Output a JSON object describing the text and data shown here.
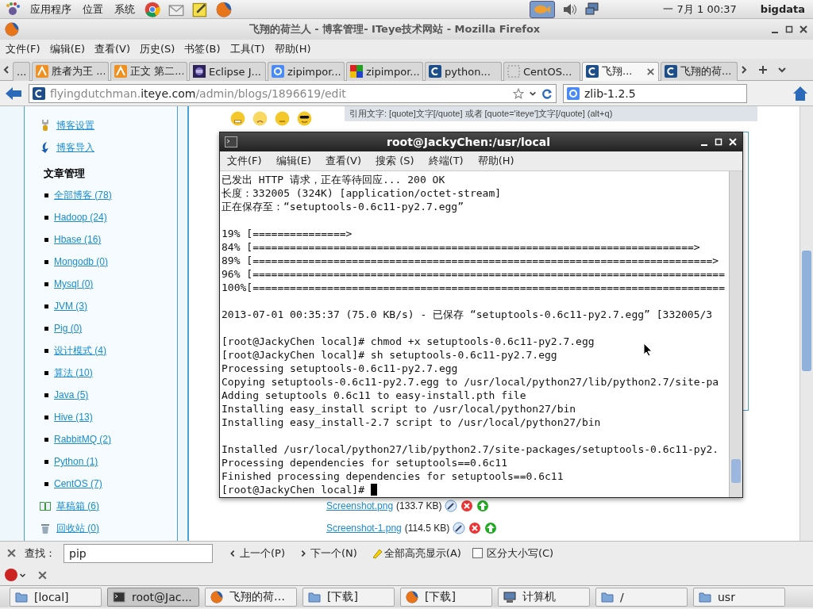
{
  "top_panel": {
    "menus": [
      "应用程序",
      "位置",
      "系统"
    ],
    "launchers": [
      {
        "kind": "chrome"
      },
      {
        "kind": "mail"
      },
      {
        "kind": "note"
      },
      {
        "kind": "firefox"
      }
    ],
    "clock": "一 7月  1 00:37",
    "user": "bigdata"
  },
  "window": {
    "title": "飞翔的荷兰人 - 博客管理- ITeye技术网站 - Mozilla Firefox"
  },
  "menu": [
    "文件(F)",
    "编辑(E)",
    "查看(V)",
    "历史(S)",
    "书签(B)",
    "工具(T)",
    "帮助(H)"
  ],
  "tabs": [
    {
      "label": "...",
      "kind": "none",
      "selected": false
    },
    {
      "label": "胜者为王 ...",
      "kind": "iteye",
      "selected": false
    },
    {
      "label": "正文 第二...",
      "kind": "iteye",
      "selected": false
    },
    {
      "label": "Eclipse J...",
      "kind": "eclipse",
      "selected": false
    },
    {
      "label": "zipimpor...",
      "kind": "google",
      "selected": false
    },
    {
      "label": "zipimpor...",
      "kind": "mosaic",
      "selected": false
    },
    {
      "label": "python...",
      "kind": "site",
      "selected": false
    },
    {
      "label": "CentOS...",
      "kind": "blank",
      "selected": false
    },
    {
      "label": "飞翔...",
      "kind": "site",
      "selected": true
    },
    {
      "label": "飞翔的荷...",
      "kind": "site",
      "selected": false
    }
  ],
  "navbar": {
    "url_host": "flyingdutchman.",
    "url_domain": "iteye.com",
    "url_path": "/admin/blogs/1896619/edit",
    "search": "zlib-1.2.5"
  },
  "sidebar": {
    "links": [
      {
        "kind": "wrench",
        "label": "博客设置"
      },
      {
        "kind": "import",
        "label": "博客导入"
      }
    ],
    "heading": "文章管理",
    "categories": [
      "全部博客 (78)",
      "Hadoop (24)",
      "Hbase (16)",
      "Mongodb (0)",
      "Mysql (0)",
      "JVM (3)",
      "Pig (0)",
      "设计模式 (4)",
      "算法 (10)",
      "Java (5)",
      "Hive (13)",
      "RabbitMQ (2)",
      "Python (1)",
      "CentOS (7)"
    ],
    "extras": [
      {
        "kind": "book",
        "label": "草稿箱 (6)"
      },
      {
        "kind": "trash",
        "label": "回收站 (0)"
      }
    ]
  },
  "editor": {
    "smileys": [
      {
        "kind": "angry"
      },
      {
        "kind": "worried"
      },
      {
        "kind": "confused"
      },
      {
        "kind": "cool"
      }
    ],
    "hint": "引用文字: [quote]文字[/quote] 或者 [quote='iteye']文字[/quote] (alt+q)",
    "attachments": [
      {
        "name": "Screenshot.png",
        "size": "(133.7 KB)"
      },
      {
        "name": "Screenshot-1.png",
        "size": "(114.5 KB)"
      }
    ]
  },
  "terminal": {
    "title": "root@JackyChen:/usr/local",
    "menu": [
      "文件(F)",
      "编辑(E)",
      "查看(V)",
      "搜索 (S)",
      "終端(T)",
      "帮助(H)"
    ],
    "cursor": true,
    "blocks": [
      [
        "已发出 HTTP 请求，正在等待回应... 200 OK",
        "长度：332005 (324K) [application/octet-stream]",
        "正在保存至：“setuptools-0.6c11-py2.7.egg”"
      ],
      [
        "19% [===============>",
        "84% [=======================================================================>",
        "89% [==========================================================================>",
        "96% [============================================================================",
        "100%[============================================================================"
      ],
      [
        "2013-07-01 00:35:37 (75.0 KB/s) - 已保存 “setuptools-0.6c11-py2.7.egg” [332005/3"
      ],
      [
        "[root@JackyChen local]# chmod +x setuptools-0.6c11-py2.7.egg",
        "[root@JackyChen local]# sh setuptools-0.6c11-py2.7.egg",
        "Processing setuptools-0.6c11-py2.7.egg",
        "Copying setuptools-0.6c11-py2.7.egg to /usr/local/python27/lib/python2.7/site-pa",
        "Adding setuptools 0.6c11 to easy-install.pth file",
        "Installing easy_install script to /usr/local/python27/bin",
        "Installing easy_install-2.7 script to /usr/local/python27/bin"
      ],
      [
        "Installed /usr/local/python27/lib/python2.7/site-packages/setuptools-0.6c11-py2.",
        "Processing dependencies for setuptools==0.6c11",
        "Finished processing dependencies for setuptools==0.6c11",
        "[root@JackyChen local]# "
      ]
    ]
  },
  "findbar": {
    "label": "查找：",
    "query": "pip",
    "prev": "上一个(P)",
    "next": "下一个(N)",
    "highlight": "全部高亮显示(A)",
    "match_case": {
      "label": "区分大小写(C)",
      "checked": false
    }
  },
  "taskbar": [
    {
      "kind": "folder",
      "label": "[local]",
      "selected": false
    },
    {
      "kind": "terminal",
      "label": "root@Jac...",
      "selected": true
    },
    {
      "kind": "firefox",
      "label": "飞翔的荷…",
      "selected": false
    },
    {
      "kind": "folder",
      "label": "[下载]",
      "selected": false
    },
    {
      "kind": "firefox",
      "label": "[下载]",
      "selected": false
    },
    {
      "kind": "computer",
      "label": "计算机",
      "selected": false
    },
    {
      "kind": "folder",
      "label": "/",
      "selected": false
    },
    {
      "kind": "folder",
      "label": "usr",
      "selected": false
    }
  ]
}
